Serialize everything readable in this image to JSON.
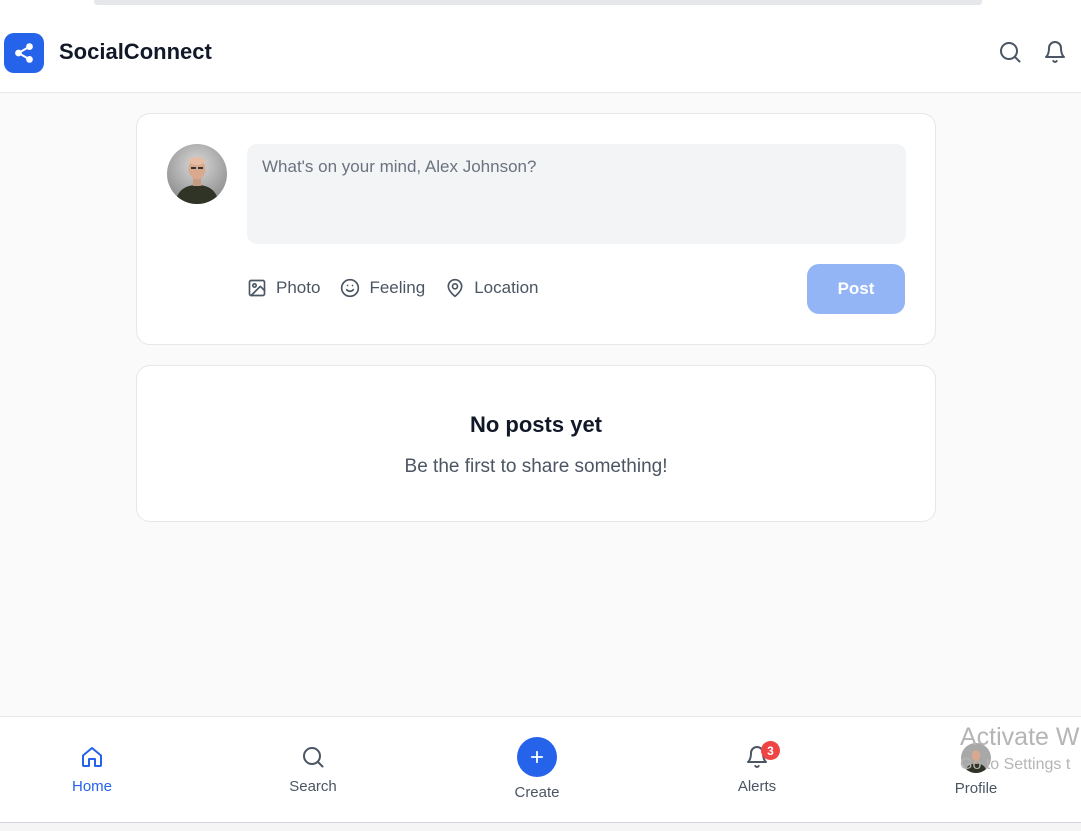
{
  "app": {
    "name": "SocialConnect",
    "brand_color": "#2563eb"
  },
  "header": {
    "icons": [
      "share-icon",
      "search-icon",
      "bell-icon"
    ]
  },
  "composer": {
    "placeholder": "What's on your mind, Alex Johnson?",
    "value": "",
    "actions": [
      {
        "icon": "image-icon",
        "label": "Photo"
      },
      {
        "icon": "smile-icon",
        "label": "Feeling"
      },
      {
        "icon": "map-pin-icon",
        "label": "Location"
      }
    ],
    "post_label": "Post",
    "post_disabled_color": "#93b4f5"
  },
  "feed": {
    "empty_title": "No posts yet",
    "empty_subtitle": "Be the first to share something!"
  },
  "bottom_nav": {
    "items": [
      {
        "label": "Home",
        "icon": "home-icon",
        "active": true
      },
      {
        "label": "Search",
        "icon": "search-icon",
        "active": false
      },
      {
        "label": "Create",
        "icon": "plus-icon",
        "active": false
      },
      {
        "label": "Alerts",
        "icon": "bell-icon",
        "active": false,
        "badge": "3"
      },
      {
        "label": "Profile",
        "icon": "avatar",
        "active": false
      }
    ],
    "badge_color": "#ef4444"
  },
  "overlay": {
    "watermark_line1": "Activate Wi",
    "watermark_line2": "Go to Settings t"
  }
}
